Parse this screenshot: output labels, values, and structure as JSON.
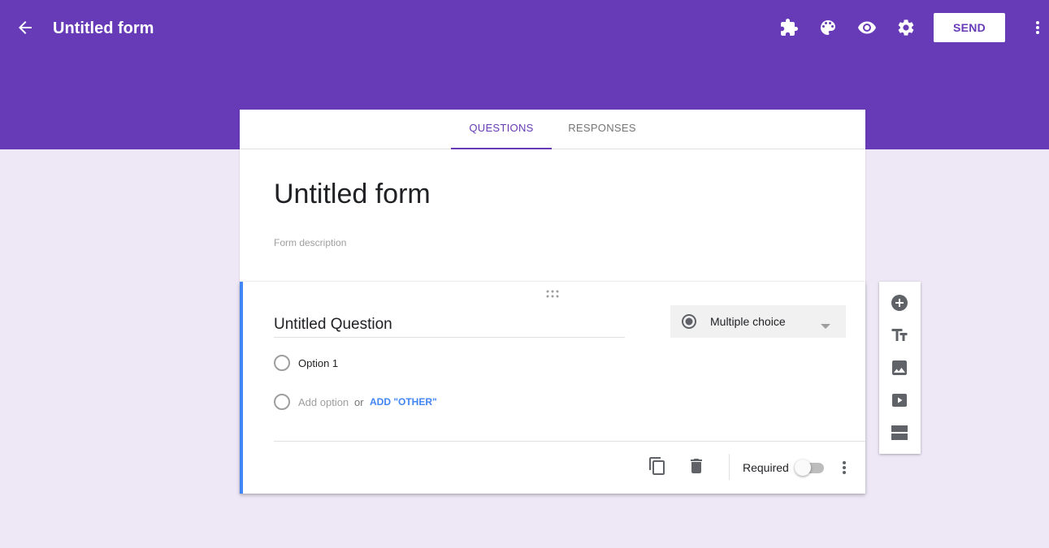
{
  "topbar": {
    "title": "Untitled form",
    "send_label": "SEND",
    "color": "#673ab7",
    "icons": [
      "arrow-back-icon",
      "puzzle-icon",
      "palette-icon",
      "eye-icon",
      "gear-icon",
      "more-vert-icon"
    ]
  },
  "tabs": [
    {
      "label": "QUESTIONS",
      "active": true
    },
    {
      "label": "RESPONSES",
      "active": false
    }
  ],
  "form": {
    "title": "Untitled form",
    "description_placeholder": "Form description"
  },
  "question": {
    "title": "Untitled Question",
    "type_label": "Multiple choice",
    "options": [
      "Option 1"
    ],
    "add_option": "Add option",
    "or_text": "or",
    "add_other": "ADD \"OTHER\"",
    "required_label": "Required",
    "required": false,
    "accent_color": "#4285f4"
  },
  "side_toolbar": {
    "icons": [
      "add-question-icon",
      "title-text-icon",
      "image-icon",
      "video-icon",
      "section-icon"
    ]
  },
  "colors": {
    "background": "#ede7f6",
    "link": "#4285f4"
  }
}
